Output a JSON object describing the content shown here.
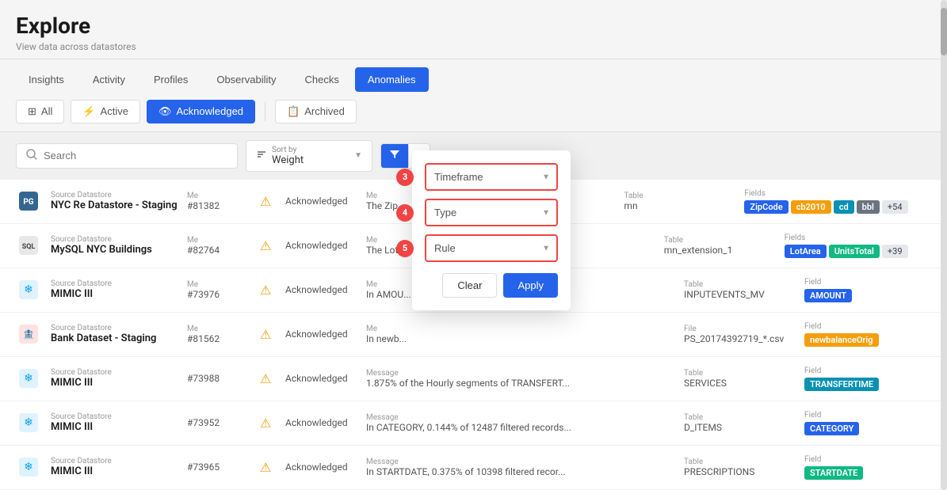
{
  "page": {
    "title": "Explore",
    "subtitle": "View data across datastores"
  },
  "nav": {
    "tabs": [
      {
        "label": "Insights",
        "active": false
      },
      {
        "label": "Activity",
        "active": false
      },
      {
        "label": "Profiles",
        "active": false
      },
      {
        "label": "Observability",
        "active": false
      },
      {
        "label": "Checks",
        "active": false
      },
      {
        "label": "Anomalies",
        "active": true
      }
    ]
  },
  "filter_tabs": [
    {
      "label": "All",
      "icon": "layers",
      "active": false
    },
    {
      "label": "Active",
      "icon": "lightning",
      "active": false
    },
    {
      "label": "Acknowledged",
      "icon": "eye",
      "active": true
    },
    {
      "label": "Archived",
      "icon": "archive",
      "active": false
    }
  ],
  "toolbar": {
    "search_placeholder": "Search",
    "sort_label": "Sort by",
    "sort_value": "Weight"
  },
  "filter_popup": {
    "timeframe_placeholder": "Timeframe",
    "type_placeholder": "Type",
    "rule_placeholder": "Rule",
    "clear_label": "Clear",
    "apply_label": "Apply",
    "steps": [
      "3",
      "4",
      "5"
    ]
  },
  "rows": [
    {
      "source_label": "Source Datastore",
      "source_name": "NYC Re Datastore - Staging",
      "id_label": "Me",
      "id_num": "#81382",
      "status_label": "",
      "status_val": "Acknowledged",
      "msg_label": "Me",
      "msg_text": "The Zip...",
      "table_label": "Table",
      "table_val": "mn",
      "fields_label": "Fields",
      "tags": [
        "ZipCode",
        "cb2010",
        "cd",
        "bbl"
      ],
      "tag_count": "+54",
      "icon_type": "postgres"
    },
    {
      "source_label": "Source Datastore",
      "source_name": "MySQL NYC Buildings",
      "id_label": "Me",
      "id_num": "#82764",
      "status_label": "",
      "status_val": "Acknowledged",
      "msg_label": "Me",
      "msg_text": "The Lot...",
      "table_label": "Table",
      "table_val": "mn_extension_1",
      "fields_label": "Fields",
      "tags": [
        "LotArea",
        "UnitsTotal"
      ],
      "tag_count": "+39",
      "icon_type": "mysql"
    },
    {
      "source_label": "Source Datastore",
      "source_name": "MIMIC III",
      "id_label": "Me",
      "id_num": "#73976",
      "status_label": "",
      "status_val": "Acknowledged",
      "msg_label": "Me",
      "msg_text": "In AMOU...",
      "table_label": "Table",
      "table_val": "INPUTEVENTS_MV",
      "fields_label": "Field",
      "tags": [
        "AMOUNT"
      ],
      "tag_count": "",
      "icon_type": "snowflake"
    },
    {
      "source_label": "Source Datastore",
      "source_name": "Bank Dataset - Staging",
      "id_label": "Me",
      "id_num": "#81562",
      "status_label": "",
      "status_val": "Acknowledged",
      "msg_label": "Me",
      "msg_text": "In newb...",
      "table_label": "File",
      "table_val": "PS_20174392719_*.csv",
      "fields_label": "Field",
      "tags": [
        "newbalanceOrig"
      ],
      "tag_count": "",
      "icon_type": "bank"
    },
    {
      "source_label": "Source Datastore",
      "source_name": "MIMIC III",
      "id_label": "",
      "id_num": "#73988",
      "status_label": "",
      "status_val": "Acknowledged",
      "msg_label": "Message",
      "msg_text": "1.875% of the Hourly segments of TRANSFERT...",
      "table_label": "Table",
      "table_val": "SERVICES",
      "fields_label": "Field",
      "tags": [
        "TRANSFERTIME"
      ],
      "tag_count": "",
      "icon_type": "snowflake"
    },
    {
      "source_label": "Source Datastore",
      "source_name": "MIMIC III",
      "id_label": "",
      "id_num": "#73952",
      "status_label": "",
      "status_val": "Acknowledged",
      "msg_label": "Message",
      "msg_text": "In CATEGORY, 0.144% of 12487 filtered records...",
      "table_label": "Table",
      "table_val": "D_ITEMS",
      "fields_label": "Field",
      "tags": [
        "CATEGORY"
      ],
      "tag_count": "",
      "icon_type": "snowflake"
    },
    {
      "source_label": "Source Datastore",
      "source_name": "MIMIC III",
      "id_label": "",
      "id_num": "#73965",
      "status_label": "",
      "status_val": "Acknowledged",
      "msg_label": "Message",
      "msg_text": "In STARTDATE, 0.375% of 10398 filtered recor...",
      "table_label": "Table",
      "table_val": "PRESCRIPTIONS",
      "fields_label": "Field",
      "tags": [
        "STARTDATE"
      ],
      "tag_count": "",
      "icon_type": "snowflake"
    }
  ],
  "tag_colors": {
    "ZipCode": "blue",
    "cb2010": "orange",
    "cd": "teal",
    "bbl": "gray",
    "LotArea": "blue",
    "UnitsTotal": "green",
    "AMOUNT": "blue",
    "newbalanceOrig": "orange",
    "TRANSFERTIME": "teal",
    "CATEGORY": "blue",
    "STARTDATE": "green"
  }
}
